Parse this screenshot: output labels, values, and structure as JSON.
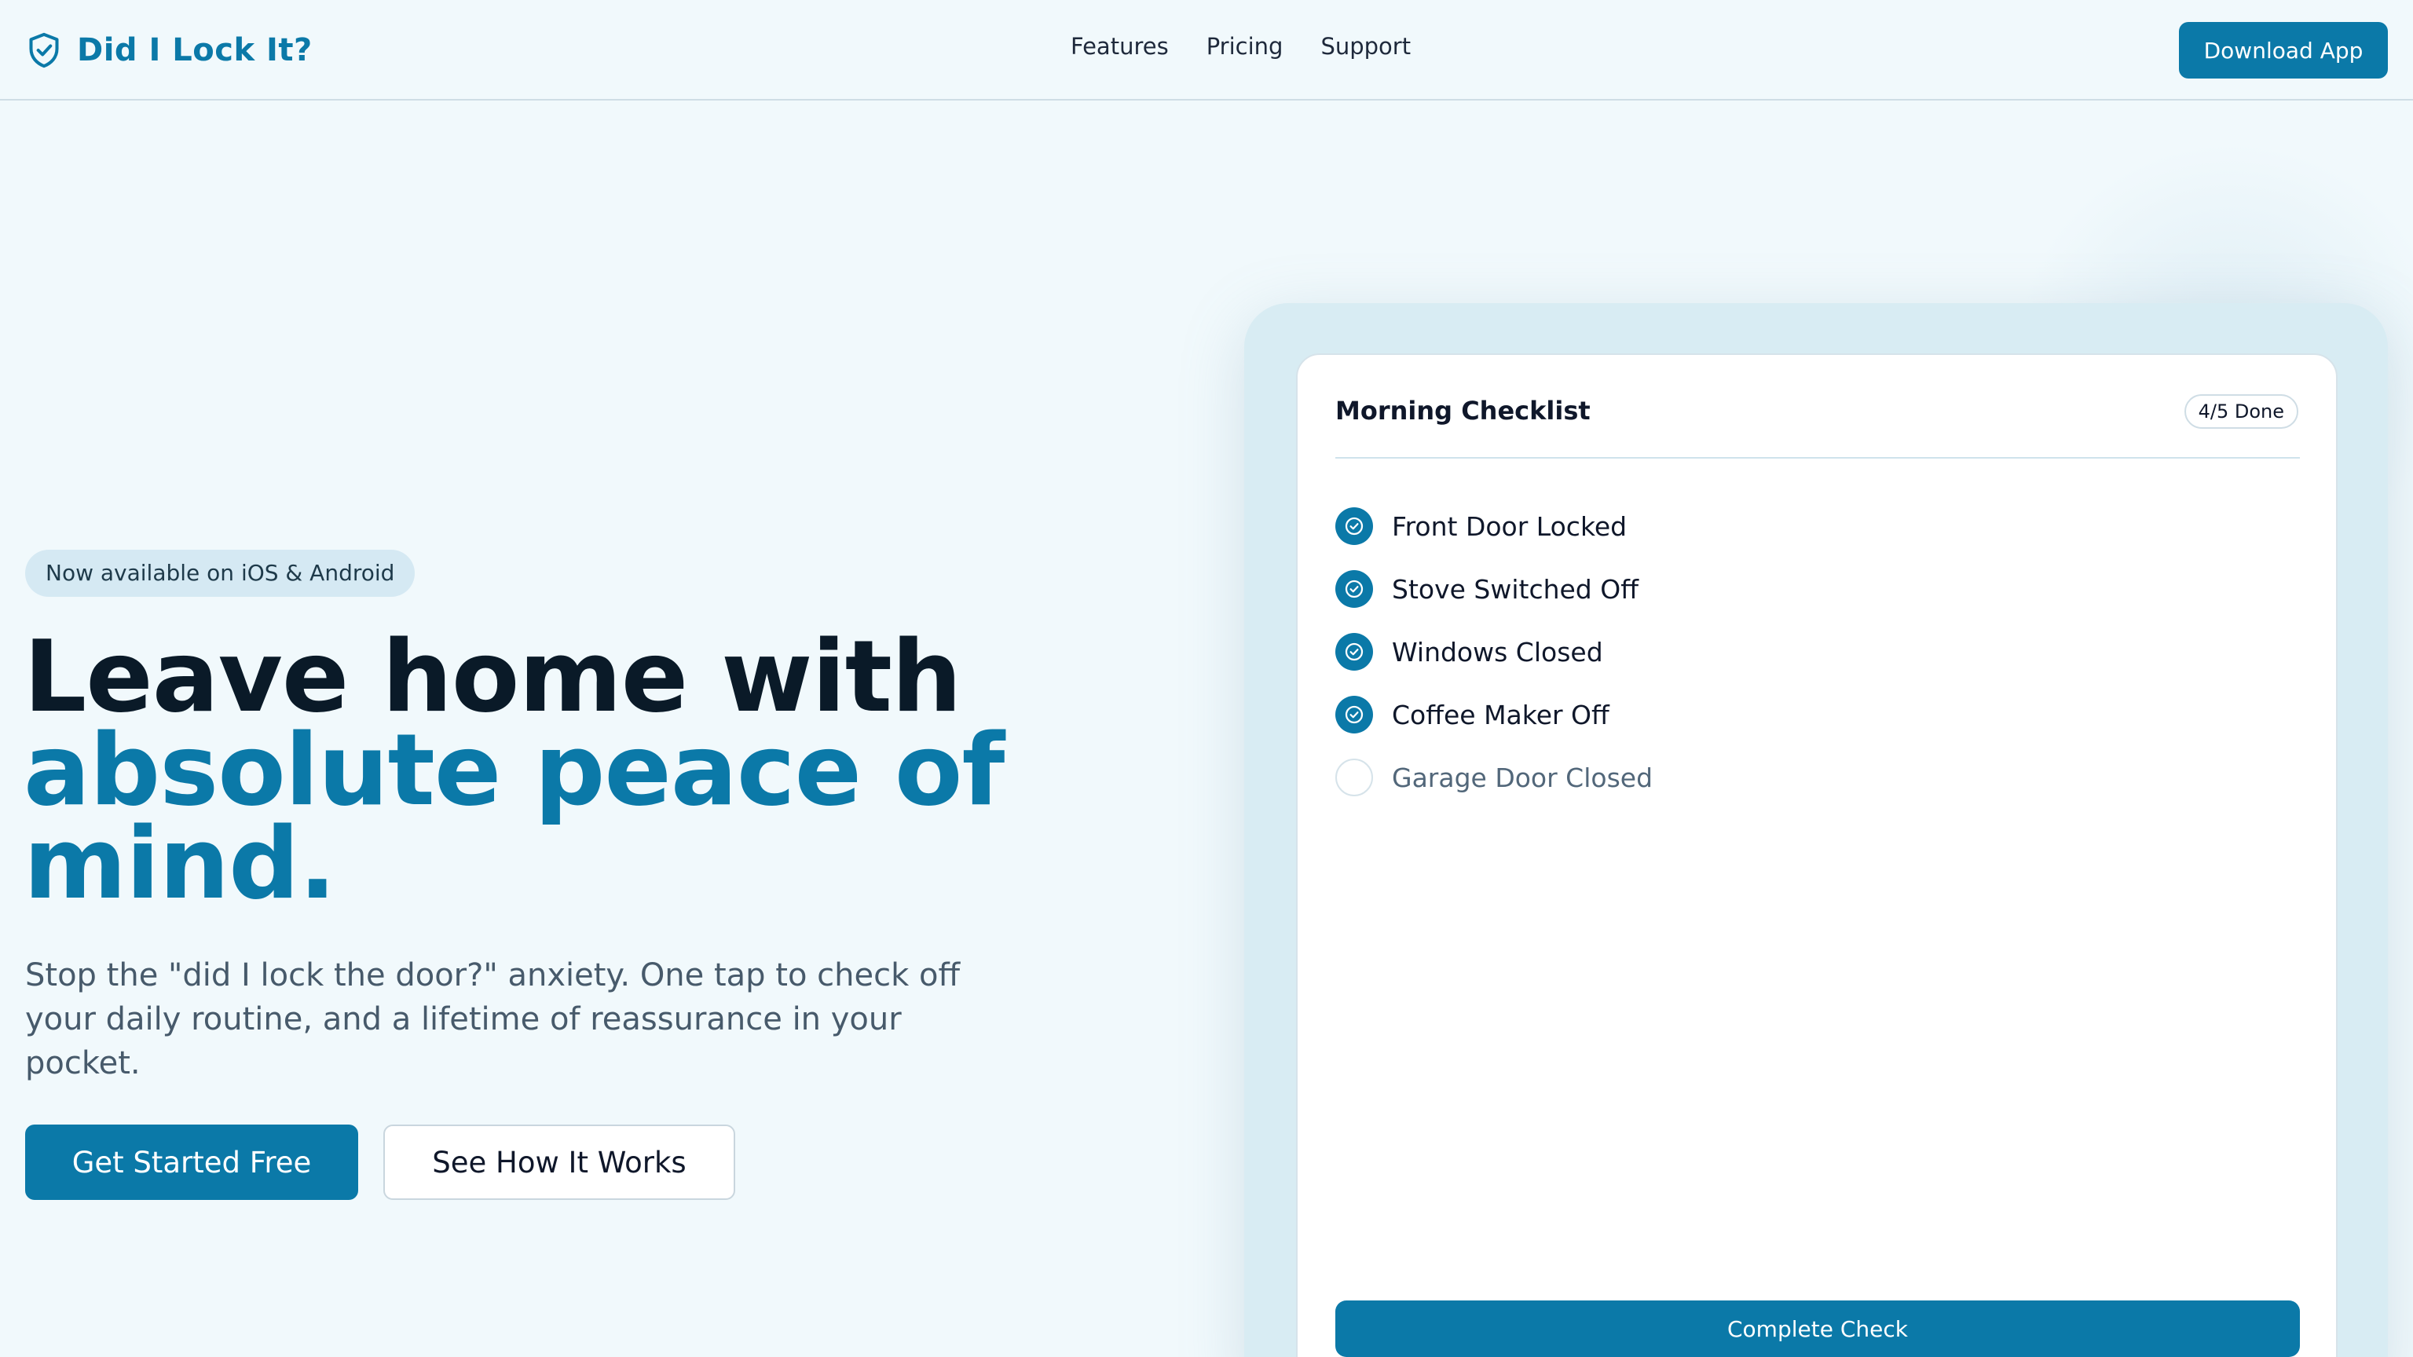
{
  "header": {
    "brand": "Did I Lock It?",
    "brand_icon": "shield-check-icon",
    "nav": [
      "Features",
      "Pricing",
      "Support"
    ],
    "download_label": "Download App"
  },
  "hero": {
    "badge": "Now available on iOS & Android",
    "headline_line1": "Leave home with",
    "headline_accent_line1": "absolute peace of",
    "headline_accent_line2": "mind.",
    "subtext": "Stop the \"did I lock the door?\" anxiety. One tap to check off your daily routine, and a lifetime of reassurance in your pocket.",
    "cta_primary": "Get Started Free",
    "cta_secondary": "See How It Works"
  },
  "checklist": {
    "title": "Morning Checklist",
    "count": "4/5 Done",
    "items": [
      {
        "label": "Front Door Locked",
        "done": true
      },
      {
        "label": "Stove Switched Off",
        "done": true
      },
      {
        "label": "Windows Closed",
        "done": true
      },
      {
        "label": "Coffee Maker Off",
        "done": true
      },
      {
        "label": "Garage Door Closed",
        "done": false
      }
    ],
    "complete_label": "Complete Check"
  },
  "colors": {
    "accent": "#0b79a8",
    "background": "#f1f9fc",
    "headline_dark": "#0a1a28"
  }
}
